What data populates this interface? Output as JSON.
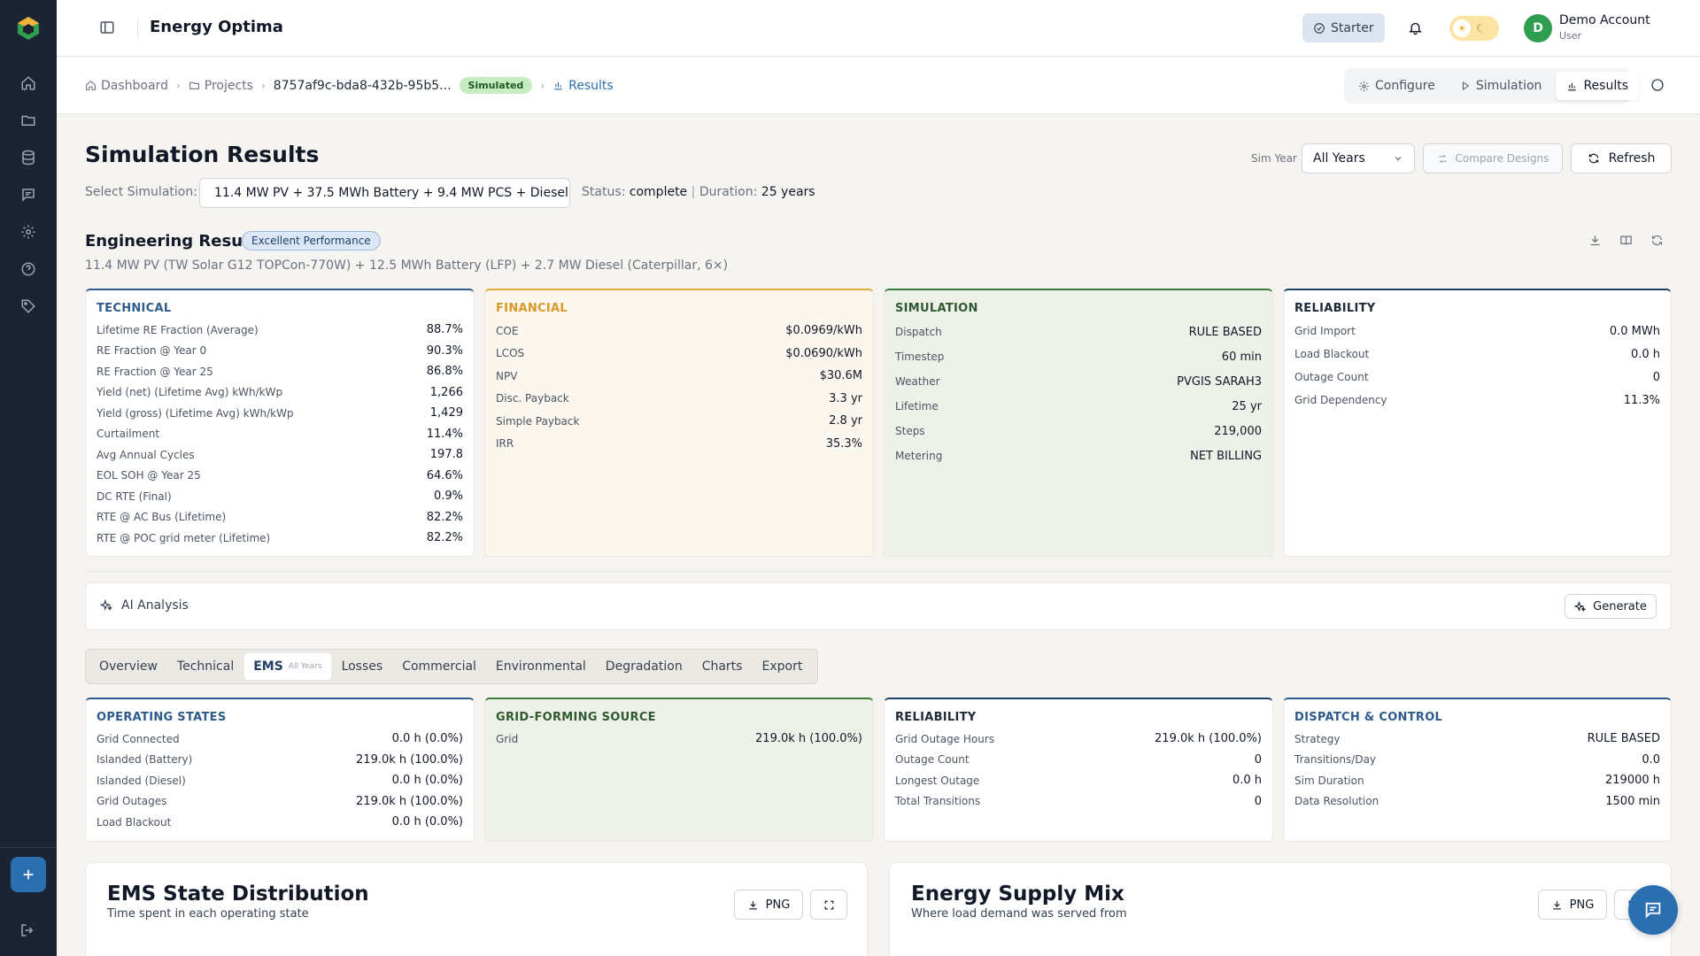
{
  "app": {
    "title": "Energy Optima"
  },
  "header": {
    "plan": "Starter",
    "account_name": "Demo Account",
    "account_role": "User",
    "avatar_letter": "D"
  },
  "breadcrumb": {
    "dashboard": "Dashboard",
    "projects": "Projects",
    "project_id": "8757af9c-bda8-432b-95b5...",
    "status": "Simulated",
    "results": "Results"
  },
  "view_tabs": {
    "configure": "Configure",
    "simulation": "Simulation",
    "results": "Results"
  },
  "page": {
    "title": "Simulation Results",
    "select_label": "Select Simulation:",
    "selected_simulation": "11.4 MW PV + 37.5 MWh Battery + 9.4 MW PCS + Diesel...",
    "status_label": "Status:",
    "status_value": "complete",
    "duration_label": "Duration:",
    "duration_value": "25 years",
    "sim_year_label": "Sim Year",
    "sim_year_value": "All Years",
    "compare_label": "Compare Designs",
    "refresh_label": "Refresh"
  },
  "engineering": {
    "title": "Engineering Results",
    "badge": "Excellent Performance",
    "subtitle": "11.4 MW PV (TW Solar G12 TOPCon-770W) + 12.5 MWh Battery (LFP) + 2.7 MW Diesel (Caterpillar, 6×)"
  },
  "cards": {
    "technical": {
      "title": "TECHNICAL",
      "rows": [
        {
          "k": "Lifetime RE Fraction (Average)",
          "v": "88.7%"
        },
        {
          "k": "RE Fraction @ Year 0",
          "v": "90.3%"
        },
        {
          "k": "RE Fraction @ Year 25",
          "v": "86.8%"
        },
        {
          "k": "Yield (net) (Lifetime Avg) kWh/kWp",
          "v": "1,266"
        },
        {
          "k": "Yield (gross) (Lifetime Avg) kWh/kWp",
          "v": "1,429"
        },
        {
          "k": "Curtailment",
          "v": "11.4%"
        },
        {
          "k": "Avg Annual Cycles",
          "v": "197.8"
        },
        {
          "k": "EOL SOH @ Year 25",
          "v": "64.6%"
        },
        {
          "k": "DC RTE (Final)",
          "v": "0.9%"
        },
        {
          "k": "RTE @ AC Bus (Lifetime)",
          "v": "82.2%"
        },
        {
          "k": "RTE @ POC grid meter (Lifetime)",
          "v": "82.2%"
        }
      ]
    },
    "financial": {
      "title": "FINANCIAL",
      "rows": [
        {
          "k": "COE",
          "v": "$0.0969/kWh"
        },
        {
          "k": "LCOS",
          "v": "$0.0690/kWh"
        },
        {
          "k": "NPV",
          "v": "$30.6M"
        },
        {
          "k": "Disc. Payback",
          "v": "3.3 yr"
        },
        {
          "k": "Simple Payback",
          "v": "2.8 yr"
        },
        {
          "k": "IRR",
          "v": "35.3%"
        }
      ]
    },
    "simulation": {
      "title": "SIMULATION",
      "rows": [
        {
          "k": "Dispatch",
          "v": "RULE BASED"
        },
        {
          "k": "Timestep",
          "v": "60 min"
        },
        {
          "k": "Weather",
          "v": "PVGIS SARAH3"
        },
        {
          "k": "Lifetime",
          "v": "25 yr"
        },
        {
          "k": "Steps",
          "v": "219,000"
        },
        {
          "k": "Metering",
          "v": "NET BILLING"
        }
      ]
    },
    "reliability": {
      "title": "RELIABILITY",
      "rows": [
        {
          "k": "Grid Import",
          "v": "0.0 MWh"
        },
        {
          "k": "Load Blackout",
          "v": "0.0 h"
        },
        {
          "k": "Outage Count",
          "v": "0"
        },
        {
          "k": "Grid Dependency",
          "v": "11.3%"
        }
      ]
    }
  },
  "ai": {
    "title": "AI Analysis",
    "generate": "Generate"
  },
  "tabs": [
    {
      "label": "Overview"
    },
    {
      "label": "Technical"
    },
    {
      "label": "EMS",
      "sub": "All Years"
    },
    {
      "label": "Losses"
    },
    {
      "label": "Commercial"
    },
    {
      "label": "Environmental"
    },
    {
      "label": "Degradation"
    },
    {
      "label": "Charts"
    },
    {
      "label": "Export"
    }
  ],
  "ems_cards": {
    "operating": {
      "title": "OPERATING STATES",
      "rows": [
        {
          "k": "Grid Connected",
          "v": "0.0 h (0.0%)"
        },
        {
          "k": "Islanded (Battery)",
          "v": "219.0k h (100.0%)"
        },
        {
          "k": "Islanded (Diesel)",
          "v": "0.0 h (0.0%)"
        },
        {
          "k": "Grid Outages",
          "v": "219.0k h (100.0%)"
        },
        {
          "k": "Load Blackout",
          "v": "0.0 h (0.0%)"
        }
      ]
    },
    "gridforming": {
      "title": "GRID-FORMING SOURCE",
      "rows": [
        {
          "k": "Grid",
          "v": "219.0k h (100.0%)"
        }
      ]
    },
    "reliability": {
      "title": "RELIABILITY",
      "rows": [
        {
          "k": "Grid Outage Hours",
          "v": "219.0k h (100.0%)"
        },
        {
          "k": "Outage Count",
          "v": "0"
        },
        {
          "k": "Longest Outage",
          "v": "0.0 h"
        },
        {
          "k": "Total Transitions",
          "v": "0"
        }
      ]
    },
    "dispatch": {
      "title": "DISPATCH & CONTROL",
      "rows": [
        {
          "k": "Strategy",
          "v": "RULE BASED"
        },
        {
          "k": "Transitions/Day",
          "v": "0.0"
        },
        {
          "k": "Sim Duration",
          "v": "219000 h"
        },
        {
          "k": "Data Resolution",
          "v": "1500 min"
        }
      ]
    }
  },
  "charts": [
    {
      "title": "EMS State Distribution",
      "subtitle": "Time spent in each operating state",
      "png": "PNG"
    },
    {
      "title": "Energy Supply Mix",
      "subtitle": "Where load demand was served from",
      "png": "PNG"
    }
  ],
  "colors": {
    "sidebar": "#1c2433",
    "accent": "#2b6fb0",
    "financial": "#d79a28",
    "simulation": "#3a7a3a"
  }
}
